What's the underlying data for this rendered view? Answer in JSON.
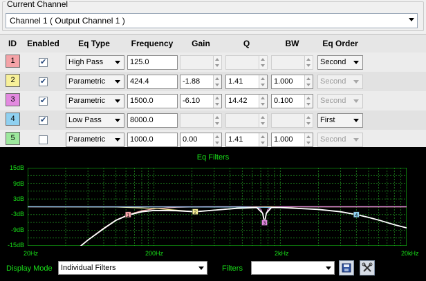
{
  "current_channel": {
    "group_label": "Current Channel",
    "selected": "Channel 1 ( Output Channel 1 )"
  },
  "columns": [
    "ID",
    "Enabled",
    "Eq Type",
    "Frequency",
    "Gain",
    "Q",
    "BW",
    "Eq Order"
  ],
  "rows": [
    {
      "id": "1",
      "color": "#f4a3a7",
      "enabled": true,
      "eq_type": "High Pass",
      "frequency": "125.0",
      "gain": "",
      "q": "",
      "bw": "",
      "eq_order": "Second",
      "order_enabled": true
    },
    {
      "id": "2",
      "color": "#f7f099",
      "enabled": true,
      "eq_type": "Parametric",
      "frequency": "424.4",
      "gain": "-1.88",
      "q": "1.41",
      "bw": "1.000",
      "eq_order": "Second",
      "order_enabled": false
    },
    {
      "id": "3",
      "color": "#e38ae0",
      "enabled": true,
      "eq_type": "Parametric",
      "frequency": "1500.0",
      "gain": "-6.10",
      "q": "14.42",
      "bw": "0.100",
      "eq_order": "Second",
      "order_enabled": false
    },
    {
      "id": "4",
      "color": "#8fd0f0",
      "enabled": true,
      "eq_type": "Low Pass",
      "frequency": "8000.0",
      "gain": "",
      "q": "",
      "bw": "",
      "eq_order": "First",
      "order_enabled": true
    },
    {
      "id": "5",
      "color": "#9de89d",
      "enabled": false,
      "eq_type": "Parametric",
      "frequency": "1000.0",
      "gain": "0.00",
      "q": "1.41",
      "bw": "1.000",
      "eq_order": "Second",
      "order_enabled": false
    }
  ],
  "plot": {
    "title": "Eq Filters",
    "y_labels": [
      "15dB",
      "9dB",
      "3dB",
      "-3dB",
      "-9dB",
      "-15dB"
    ],
    "x_labels": [
      "20Hz",
      "200Hz",
      "2kHz",
      "20kHz"
    ],
    "accent": "#19e019"
  },
  "chart_data": {
    "type": "line",
    "title": "Eq Filters",
    "xscale": "log",
    "xlim": [
      20,
      20000
    ],
    "ylim": [
      -15,
      15
    ],
    "x_ticks": [
      "20Hz",
      "200Hz",
      "2kHz",
      "20kHz"
    ],
    "y_ticks": [
      "15dB",
      "9dB",
      "3dB",
      "-3dB",
      "-9dB",
      "-15dB"
    ],
    "grid": true,
    "series": [
      {
        "color": "#f4a3a7",
        "x": [
          20,
          40,
          60,
          80,
          100,
          125,
          160,
          200,
          300,
          500,
          1000,
          2000,
          5000,
          10000,
          20000
        ],
        "y": [
          -31.8,
          -19.7,
          -12.7,
          -8.2,
          -5.1,
          -3.0,
          -1.5,
          -0.8,
          -0.2,
          0,
          0,
          0,
          0,
          0,
          0
        ]
      },
      {
        "color": "#f7f099",
        "x": [
          20,
          100,
          200,
          300,
          424.4,
          600,
          900,
          1500,
          3000,
          20000
        ],
        "y": [
          0,
          -0.1,
          -0.6,
          -1.3,
          -1.88,
          -1.3,
          -0.5,
          -0.1,
          0,
          0
        ]
      },
      {
        "color": "#e38ae0",
        "x": [
          20,
          1000,
          1300,
          1400,
          1450,
          1500,
          1550,
          1600,
          1700,
          2000,
          20000
        ],
        "y": [
          0,
          0,
          -0.2,
          -0.9,
          -2.5,
          -6.1,
          -2.5,
          -0.9,
          -0.2,
          0,
          0
        ]
      },
      {
        "color": "#8fd0f0",
        "x": [
          20,
          1000,
          2000,
          4000,
          6000,
          8000,
          10000,
          12000,
          16000,
          20000
        ],
        "y": [
          0,
          -0.1,
          -0.3,
          -1.0,
          -1.9,
          -3.0,
          -4.1,
          -5.1,
          -6.9,
          -8.1
        ]
      },
      {
        "color": "#ffffff",
        "x": [
          20,
          40,
          60,
          80,
          100,
          125,
          160,
          200,
          300,
          424.4,
          600,
          900,
          1300,
          1450,
          1500,
          1550,
          1700,
          2000,
          4000,
          6000,
          8000,
          10000,
          12000,
          16000,
          20000
        ],
        "y": [
          -31.8,
          -19.8,
          -12.8,
          -8.4,
          -5.2,
          -3.2,
          -1.9,
          -1.4,
          -1.5,
          -1.9,
          -1.3,
          -0.6,
          -0.3,
          -2.5,
          -6.1,
          -2.5,
          -0.3,
          -0.3,
          -1.0,
          -1.9,
          -3.0,
          -4.1,
          -5.1,
          -6.9,
          -8.1
        ]
      }
    ],
    "markers": [
      {
        "label": "1",
        "x": 125,
        "y": -3.0,
        "color": "#f4a3a7"
      },
      {
        "label": "2",
        "x": 424.4,
        "y": -1.88,
        "color": "#f7f099"
      },
      {
        "label": "3",
        "x": 1500,
        "y": -6.1,
        "color": "#e38ae0"
      },
      {
        "label": "4",
        "x": 8000,
        "y": -3.0,
        "color": "#8fd0f0"
      }
    ]
  },
  "footer": {
    "display_mode_label": "Display Mode",
    "display_mode_value": "Individual Filters",
    "filters_label": "Filters",
    "filters_value": ""
  }
}
